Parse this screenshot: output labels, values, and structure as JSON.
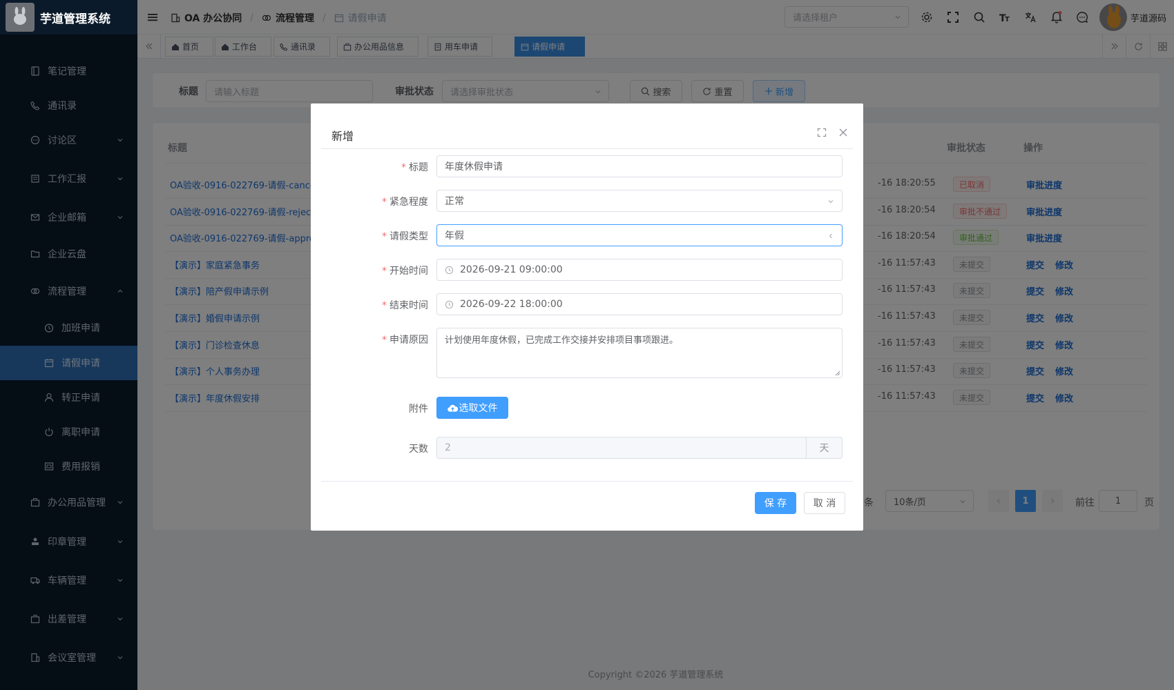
{
  "app": {
    "title": "芋道管理系统",
    "logo_alt": "logo"
  },
  "sidebar": {
    "items": [
      {
        "label": "笔记管理",
        "icon": "notebook-icon"
      },
      {
        "label": "通讯录",
        "icon": "phone-icon"
      },
      {
        "label": "讨论区",
        "icon": "chat-icon"
      },
      {
        "label": "工作汇报",
        "icon": "report-icon"
      },
      {
        "label": "企业邮箱",
        "icon": "mail-icon"
      },
      {
        "label": "企业云盘",
        "icon": "folder-icon"
      },
      {
        "label": "流程管理",
        "icon": "flow-icon"
      },
      {
        "label": "加班申请",
        "icon": "clock-icon"
      },
      {
        "label": "请假申请",
        "icon": "calendar-icon"
      },
      {
        "label": "转正申请",
        "icon": "user-icon"
      },
      {
        "label": "离职申请",
        "icon": "power-icon"
      },
      {
        "label": "费用报销",
        "icon": "receipt-icon"
      },
      {
        "label": "办公用品管理",
        "icon": "box-icon"
      },
      {
        "label": "印章管理",
        "icon": "stamp-icon"
      },
      {
        "label": "车辆管理",
        "icon": "truck-icon"
      },
      {
        "label": "出差管理",
        "icon": "briefcase-icon"
      },
      {
        "label": "会议室管理",
        "icon": "building-icon"
      }
    ]
  },
  "header": {
    "breadcrumb": [
      "OA 办公协同",
      "流程管理",
      "请假申请"
    ],
    "tenant_placeholder": "请选择租户",
    "username": "芋道源码"
  },
  "tags": [
    "首页",
    "工作台",
    "通讯录",
    "办公用品信息",
    "用车申请",
    "请假申请"
  ],
  "search": {
    "title_label": "标题",
    "title_placeholder": "请输入标题",
    "status_label": "审批状态",
    "status_placeholder": "请选择审批状态",
    "search_btn": "搜索",
    "reset_btn": "重置",
    "add_btn": "新增"
  },
  "table": {
    "headers": {
      "title": "标题",
      "status": "审批状态",
      "ops": "操作"
    },
    "rows": [
      {
        "title": "OA验收-0916-022769-请假-cance",
        "time": "-16 18:20:55",
        "status": "已取消",
        "status_color": "#f56c6c",
        "ops": [
          "审批进度"
        ]
      },
      {
        "title": "OA验收-0916-022769-请假-rejec",
        "time": "-16 18:20:54",
        "status": "审批不通过",
        "status_color": "#f56c6c",
        "ops": [
          "审批进度"
        ]
      },
      {
        "title": "OA验收-0916-022769-请假-appro",
        "time": "-16 18:20:54",
        "status": "审批通过",
        "status_color": "#67c23a",
        "ops": [
          "审批进度"
        ]
      },
      {
        "title": "【演示】家庭紧急事务",
        "time": "-16 11:57:43",
        "status": "未提交",
        "status_color": "#909399",
        "ops": [
          "提交",
          "修改"
        ]
      },
      {
        "title": "【演示】陪产假申请示例",
        "time": "-16 11:57:43",
        "status": "未提交",
        "status_color": "#909399",
        "ops": [
          "提交",
          "修改"
        ]
      },
      {
        "title": "【演示】婚假申请示例",
        "time": "-16 11:57:43",
        "status": "未提交",
        "status_color": "#909399",
        "ops": [
          "提交",
          "修改"
        ]
      },
      {
        "title": "【演示】门诊检查休息",
        "time": "-16 11:57:43",
        "status": "未提交",
        "status_color": "#909399",
        "ops": [
          "提交",
          "修改"
        ]
      },
      {
        "title": "【演示】个人事务办理",
        "time": "-16 11:57:43",
        "status": "未提交",
        "status_color": "#909399",
        "ops": [
          "提交",
          "修改"
        ]
      },
      {
        "title": "【演示】年度休假安排",
        "time": "-16 11:57:43",
        "status": "未提交",
        "status_color": "#909399",
        "ops": [
          "提交",
          "修改"
        ]
      }
    ]
  },
  "pagination": {
    "total_suffix": "条",
    "page_size": "10条/页",
    "current": "1",
    "goto_label": "前往",
    "goto_value": "1",
    "page_suffix": "页"
  },
  "footer": {
    "copyright": "Copyright ©2026 芋道管理系统"
  },
  "dialog": {
    "title": "新增",
    "fields": {
      "title": {
        "label": "标题",
        "value": "年度休假申请"
      },
      "urgency": {
        "label": "紧急程度",
        "value": "正常"
      },
      "leave_type": {
        "label": "请假类型",
        "value": "年假"
      },
      "start_time": {
        "label": "开始时间",
        "value": "2026-09-21 09:00:00"
      },
      "end_time": {
        "label": "结束时间",
        "value": "2026-09-22 18:00:00"
      },
      "reason": {
        "label": "申请原因",
        "value": "计划使用年度休假，已完成工作交接并安排项目事项跟进。"
      },
      "attachment": {
        "label": "附件",
        "button": "选取文件"
      },
      "days": {
        "label": "天数",
        "value": "2",
        "unit": "天"
      }
    },
    "save_btn": "保 存",
    "cancel_btn": "取 消"
  },
  "colors": {
    "primary": "#409eff",
    "sidebar_bg": "#0b1a2b",
    "active_menu": "#2f6fb7",
    "link": "#1b6dd6"
  }
}
